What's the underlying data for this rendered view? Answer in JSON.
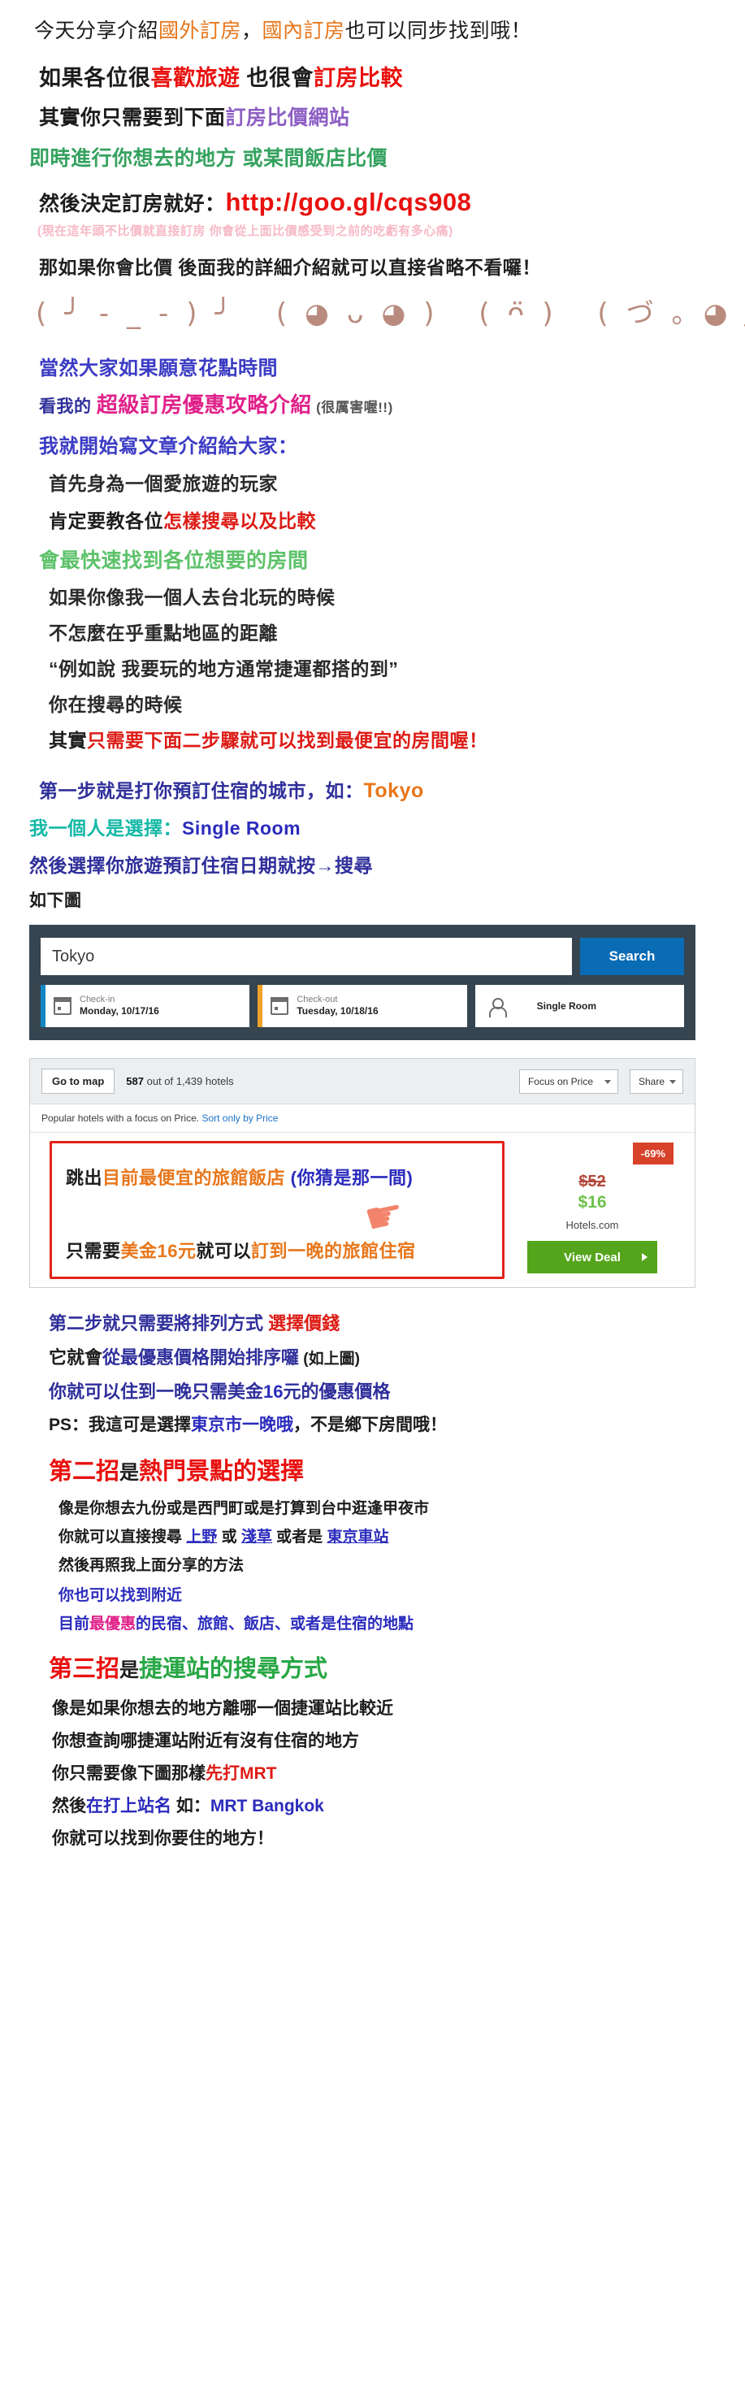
{
  "intro": {
    "title_parts": [
      {
        "t": "今天分享介紹",
        "c": "black"
      },
      {
        "t": "國外訂房",
        "c": "orange"
      },
      {
        "t": "，",
        "c": "black"
      },
      {
        "t": "國內訂房",
        "c": "orange"
      },
      {
        "t": "也可以同步找到哦！",
        "c": "black"
      }
    ],
    "line1_a": "如果各位很",
    "line1_b": "喜歡旅遊",
    "line1_c": " 也很會",
    "line1_d": "訂房比較",
    "line2_a": "其實你只需要到下面",
    "line2_b": "訂房比價網站",
    "line3": "即時進行你想去的地方 或某間飯店比價",
    "line4_a": "然後決定訂房就好：",
    "line4_url": "http://goo.gl/cqs908",
    "line5_a": "(現在這年頭不比價就直接訂房 你會從上面比價感受到之前的吃虧有",
    "line5_b": "多心痛",
    "line5_c": ")",
    "line6": "那如果你會比價 後面我的詳細介紹就可以直接省略不看囉！",
    "emoji_row": "(╯-_-)╯ (◕ᴗ◕) (ᴖ̈) (づ｡◕‿◕｡)づ (˘⌣˘) (¬‿¬) (✿◠‿◠)",
    "line7": "當然大家如果願意花點時間",
    "line8_a": "看我的 ",
    "line8_b": "超級訂房優惠攻略介紹",
    "line8_c": " (很厲害喔!!)",
    "line9": "我就開始寫文章介紹給大家：",
    "line10": "首先身為一個愛旅遊的玩家",
    "line11_a": "肯定要教各位",
    "line11_b": "怎樣搜尋以及比較",
    "line12": "會最快速找到各位想要的房間",
    "line13": "如果你像我一個人去台北玩的時候",
    "line14": "不怎麼在乎重點地區的距離",
    "line15": "“例如說 我要玩的地方通常捷運都搭的到”",
    "line16": "你在搜尋的時候",
    "line17_a": "其實",
    "line17_b": "只需要下面二步驟就可以找到最便宜的房間喔！"
  },
  "step1": {
    "line1_a": "第一步就是打你預訂住宿的城市，如：",
    "line1_b": "Tokyo",
    "line2_a": "我一個人是選擇：",
    "line2_b": "Single Room",
    "line3": "然後選擇你旅遊預訂住宿日期就按→搜尋",
    "line4": "如下圖"
  },
  "search_widget": {
    "destination_value": "Tokyo",
    "destination_placeholder": "Tokyo",
    "search_button": "Search",
    "checkin_label": "Check-in",
    "checkin_value": "Monday, 10/17/16",
    "checkout_label": "Check-out",
    "checkout_value": "Tuesday, 10/18/16",
    "room_value": "Single Room",
    "calendar_icon": "calendar-icon",
    "person_icon": "person-icon"
  },
  "results": {
    "go_to_map": "Go to map",
    "count_bold": "587",
    "count_rest": " out of 1,439 hotels",
    "focus_select": "Focus on Price",
    "share_select": "Share",
    "sort_text": "Popular hotels with a focus on Price. ",
    "sort_link": "Sort only by Price",
    "annotation_line1_a": "跳出",
    "annotation_line1_b": "目前最便宜的旅館飯店",
    "annotation_line1_c": " (你猜是那一間)",
    "annotation_line2_a": "只需要",
    "annotation_line2_b": "美金16元",
    "annotation_line2_c": "就可以",
    "annotation_line2_d": "訂到一晚的旅館住宿",
    "discount_badge": "-69%",
    "price_old": "$52",
    "price_new": "$16",
    "price_source": "Hotels.com",
    "view_deal": "View Deal",
    "hand_icon": "pointing-hand-icon"
  },
  "step2": {
    "line1_a": "第二步就只需要將排列方式  ",
    "line1_b": "選擇價錢",
    "line2_a": "它就會",
    "line2_b": "從最優惠價格開始排序囉",
    "line2_c": " (如上圖)",
    "line3_a": "你就可以住到",
    "line3_b": "一晚只需美金",
    "line3_c": "16",
    "line3_d": "元的優惠價格",
    "line4_a": "PS：我這可是選擇",
    "line4_b": "東京市一晚哦",
    "line4_c": "，不是鄉下房間哦！"
  },
  "trick2": {
    "heading_a": "第二招",
    "heading_b": "是",
    "heading_c": "熱門景點的選擇",
    "line1": "像是你想去九份或是西門町或是打算到台中逛逢甲夜市",
    "line2_a": "你就可以直接搜尋 ",
    "line2_b": "上野",
    "line2_c": " 或 ",
    "line2_d": "淺草",
    "line2_e": " 或者是 ",
    "line2_f": "東京車站",
    "line3": "然後再照我上面分享的方法",
    "line4": "你也可以找到附近",
    "line5_a": "目前",
    "line5_b": "最優惠",
    "line5_c": "的民宿、旅館、飯店、或者是住宿的地點"
  },
  "trick3": {
    "heading_a": "第三招",
    "heading_b": "是",
    "heading_c": "捷運站的搜尋方式",
    "line1": "像是如果你想去的地方離哪一個捷運站比較近",
    "line2": "你想查詢哪捷運站附近有沒有住宿的地方",
    "line3_a": "你只需要像下圖那樣",
    "line3_b": "先打MRT",
    "line4_a": "然後",
    "line4_b": "在打上站名",
    "line4_c": "  如：",
    "line4_d": "MRT Bangkok",
    "line5": "你就可以找到你要住的地方！"
  },
  "colors": {
    "orange": "#e8761a",
    "red": "#e8110f",
    "purple": "#8d5fc4",
    "green": "#35a25f",
    "teal": "#14b8a6",
    "blue": "#3b3bc4",
    "pink": "#e0218a",
    "light_pink": "#f7b9c6",
    "widget_bg": "#36454f",
    "search_btn": "#0a6cb4",
    "deal_green": "#55a51c",
    "discount_red": "#d7422a",
    "price_green": "#6cc24a"
  }
}
